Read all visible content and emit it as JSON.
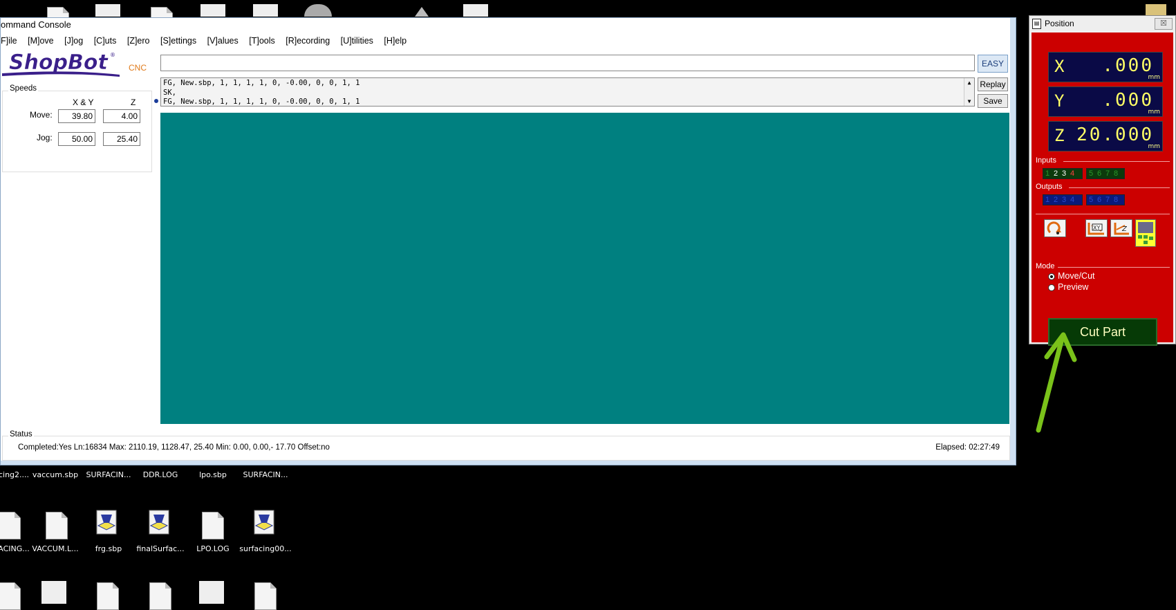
{
  "console": {
    "title": "ommand Console",
    "menu": [
      "F]ile",
      "[M]ove",
      "[J]og",
      "[C]uts",
      "[Z]ero",
      "[S]ettings",
      "[V]alues",
      "[T]ools",
      "[R]ecording",
      "[U]tilities",
      "[H]elp"
    ],
    "logo_text": "ShopBot",
    "logo_reg": "®",
    "logo_cnc": "CNC",
    "command_value": "",
    "easy_label": "EASY",
    "replay_label": "Replay",
    "save_label": "Save",
    "history": [
      "FG, New.sbp,  1,  1,  1,  1,  0, -0.00, 0, 0,  1,  1",
      "SK,",
      "FG, New.sbp,  1,  1,  1,  1,  0, -0.00, 0, 0,  1,  1"
    ]
  },
  "speeds": {
    "legend": "Speeds",
    "col_xy": "X & Y",
    "col_z": "Z",
    "move_label": "Move:",
    "jog_label": "Jog:",
    "move_xy": "39.80",
    "move_z": "4.00",
    "jog_xy": "50.00",
    "jog_z": "25.40"
  },
  "status": {
    "legend": "Status",
    "text": "Completed:Yes Ln:16834 Max: 2110.19, 1128.47, 25.40  Min: 0.00, 0.00,- 17.70  Offset:no",
    "elapsed": "Elapsed: 02:27:49"
  },
  "position": {
    "title": "Position",
    "close_glyph": "☒",
    "axes": [
      {
        "axis": "X",
        "value": ".000",
        "unit": "mm"
      },
      {
        "axis": "Y",
        "value": ".000",
        "unit": "mm"
      },
      {
        "axis": "Z",
        "value": "20.000",
        "unit": "mm"
      }
    ],
    "inputs_label": "Inputs",
    "outputs_label": "Outputs",
    "inputs_a": [
      "1",
      "2",
      "3",
      "4"
    ],
    "inputs_b": [
      "5",
      "6",
      "7",
      "8"
    ],
    "outputs_a": [
      "1",
      "2",
      "3",
      "4"
    ],
    "outputs_b": [
      "5",
      "6",
      "7",
      "8"
    ],
    "mode_label": "Mode",
    "mode_move_cut": "Move/Cut",
    "mode_preview": "Preview",
    "cut_part_label": "Cut Part"
  },
  "desktop": {
    "row1": [
      "cing2....",
      "vaccum.sbp",
      "SURFACIN...",
      "DDR.LOG",
      "lpo.sbp",
      "SURFACIN..."
    ],
    "row2": [
      "ACING...",
      "VACCUM.L...",
      "frg.sbp",
      "finalSurfac...",
      "LPO.LOG",
      "surfacing00..."
    ]
  },
  "colors": {
    "canvas": "#008080",
    "position_panel": "#cc0000",
    "dro_bg": "#0a0a46",
    "dro_text": "#ffff66",
    "cut_part_bg": "#063a06",
    "arrow": "#7ac21a"
  }
}
